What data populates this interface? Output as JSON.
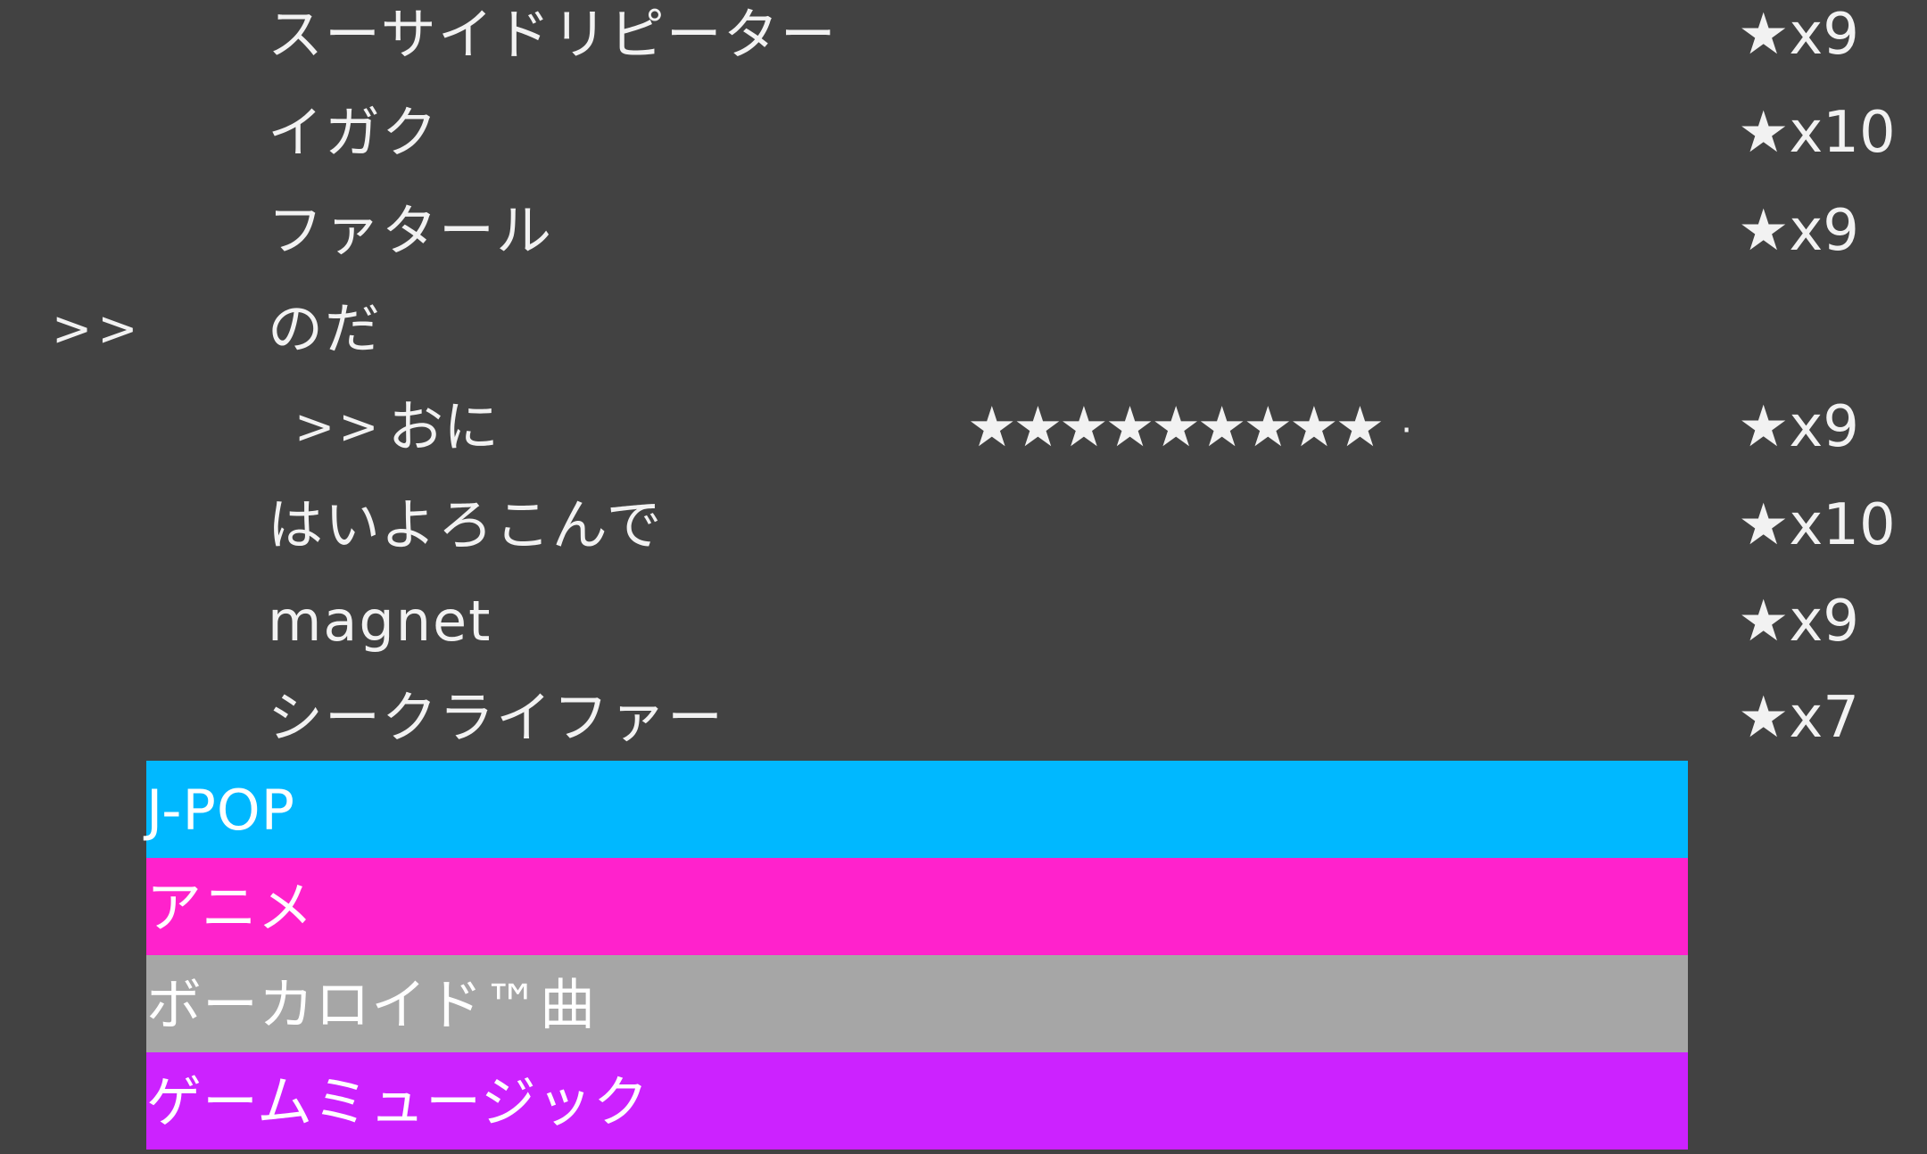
{
  "songs": [
    {
      "title": "スーサイドリピーター",
      "level": "★x9"
    },
    {
      "title": "イガク",
      "level": "★x10"
    },
    {
      "title": "ファタール",
      "level": "★x9"
    },
    {
      "title": "のだ",
      "level": "",
      "cursor": ">>"
    },
    {
      "title": "はいよろこんで",
      "level": "★x10"
    },
    {
      "title": "magnet",
      "level": "★x9"
    },
    {
      "title": "シークライファー",
      "level": "★x7"
    }
  ],
  "selected_course": {
    "cursor": ">>",
    "name": "おに",
    "star_meter": "★★★★★★★★★",
    "star_meter_filled": 9,
    "star_meter_trailing": "·",
    "level": "★x9"
  },
  "genres": [
    {
      "label": "J-POP",
      "color": "#00b8ff"
    },
    {
      "label": "アニメ",
      "color": "#ff22cc"
    },
    {
      "label": "ボーカロイド™曲",
      "color": "#a6a6a6"
    },
    {
      "label": "ゲームミュージック",
      "color": "#cc22ff"
    }
  ],
  "colors": {
    "background": "#424242",
    "text": "#f2f2f2"
  }
}
